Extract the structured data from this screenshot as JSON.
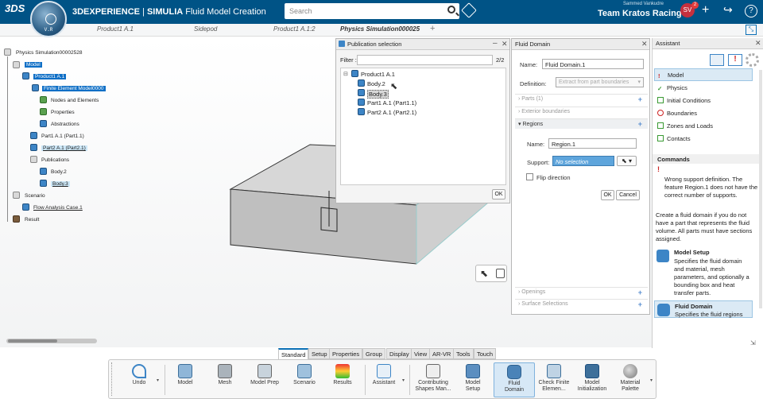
{
  "topbar": {
    "brand_bold": "3DEXPERIENCE",
    "brand_sep": " | ",
    "brand_app": "SIMULIA",
    "brand_product": " Fluid Model Creation",
    "compass_version": "V.R",
    "compass_label": "3D",
    "search_placeholder": "Search",
    "user_name": "Sammed Vankudre",
    "team": "Team Kratos Racing",
    "avatar_initials": "SV",
    "avatar_count": "2",
    "brand_color": "#005386"
  },
  "doc_tabs": [
    "Product1 A.1",
    "Sidepod",
    "Product1 A.1:2",
    "Physics Simulation000025"
  ],
  "tree": {
    "root": "Physics Simulation00002528",
    "items": [
      {
        "label": "Model"
      },
      {
        "label": "Product1 A.1"
      },
      {
        "label": "Finite Element Model0000"
      },
      {
        "label": "Nodes and Elements"
      },
      {
        "label": "Properties"
      },
      {
        "label": "Abstractions"
      },
      {
        "label": "Part1 A.1 (Part1.1)"
      },
      {
        "label": "Part2 A.1 (Part2.1)"
      },
      {
        "label": "Publications"
      },
      {
        "label": "Body.2"
      },
      {
        "label": "Body.3"
      },
      {
        "label": "Scenario"
      },
      {
        "label": "Flow Analysis Case.1"
      },
      {
        "label": "Result"
      }
    ]
  },
  "publication": {
    "title": "Publication selection",
    "filter_label": "Filter :",
    "filter_value": "",
    "count": "2/2",
    "items": [
      "Product1 A.1",
      "Body.2",
      "Body.3",
      "Part1 A.1 (Part1.1)",
      "Part2 A.1 (Part2.1)"
    ],
    "ok": "OK"
  },
  "fluid": {
    "title": "Fluid Domain",
    "name_label": "Name:",
    "name_value": "Fluid Domain.1",
    "definition_label": "Definition:",
    "definition_value": "Extract from part boundaries",
    "sections": {
      "parts": "Parts (1)",
      "exterior": "Exterior boundaries",
      "regions": "Regions",
      "openings": "Openings",
      "surface": "Surface Selections"
    },
    "region_name_label": "Name:",
    "region_name_value": "Region.1",
    "support_label": "Support:",
    "support_value": "No selection",
    "flip_label": "Flip direction",
    "ok": "OK",
    "cancel": "Cancel"
  },
  "assistant": {
    "title": "Assistant",
    "items": [
      {
        "label": "Model",
        "status": "error"
      },
      {
        "label": "Physics",
        "status": "done"
      },
      {
        "label": "Initial Conditions",
        "status": "todo"
      },
      {
        "label": "Boundaries",
        "status": "required"
      },
      {
        "label": "Zones and Loads",
        "status": "todo"
      },
      {
        "label": "Contacts",
        "status": "todo"
      }
    ],
    "commands_title": "Commands",
    "error_text": "Wrong support definition. The feature Region.1 does not have the correct number of supports.",
    "help_text": "Create a fluid domain if you do not have a part that represents the fluid volume. All parts must have sections assigned.",
    "model_setup_title": "Model Setup",
    "model_setup_text": "Specifies the fluid domain and material, mesh parameters, and optionally a bounding box and heat transfer parts.",
    "fluid_domain_title": "Fluid Domain",
    "fluid_domain_text": "Specifies the fluid regions"
  },
  "bottom_tabs": [
    "Standard",
    "Setup",
    "Properties",
    "Group",
    "Display",
    "View",
    "AR-VR",
    "Tools",
    "Touch"
  ],
  "actions": [
    {
      "label": "Undo",
      "icon": "undo-icon"
    },
    {
      "label": "Model",
      "icon": "model-icon"
    },
    {
      "label": "Mesh",
      "icon": "mesh-icon"
    },
    {
      "label": "Model Prep",
      "icon": "model-prep-icon"
    },
    {
      "label": "Scenario",
      "icon": "scenario-icon"
    },
    {
      "label": "Results",
      "icon": "results-icon"
    },
    {
      "label": "Assistant",
      "icon": "assistant-icon"
    },
    {
      "label": "Contributing Shapes Man...",
      "icon": "contributing-shapes-icon"
    },
    {
      "label": "Model Setup",
      "icon": "model-setup-icon"
    },
    {
      "label": "Fluid Domain",
      "icon": "fluid-domain-icon"
    },
    {
      "label": "Check Finite Elemen...",
      "icon": "check-fe-icon"
    },
    {
      "label": "Model Initialization",
      "icon": "model-init-icon"
    },
    {
      "label": "Material Palette",
      "icon": "material-palette-icon"
    }
  ]
}
